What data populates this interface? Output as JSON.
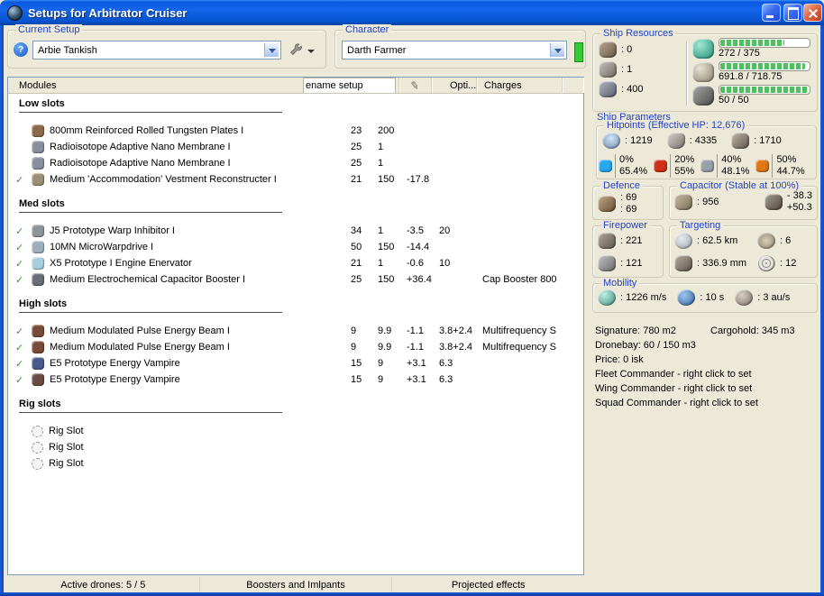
{
  "window": {
    "title": "Setups for Arbitrator Cruiser",
    "controls": [
      "minimize",
      "maximize",
      "close"
    ]
  },
  "icons": {
    "check": "✓",
    "help": "?",
    "pen": "✎"
  },
  "colors": {
    "indicator_green": "#33cc33",
    "bar_green": "#4fbf5f",
    "titlebar_blue": "#0a59e0"
  },
  "toolbar": {
    "current_setup": {
      "label": "Current Setup",
      "value": "Arbie Tankish"
    },
    "character": {
      "label": "Character",
      "value": "Darth Farmer"
    }
  },
  "tooltip": {
    "text": "ename setup"
  },
  "modules_panel": {
    "header": {
      "modules": "Modules",
      "opti": "Opti...",
      "charges": "Charges"
    },
    "sections": [
      {
        "title": "Low slots",
        "rows": [
          {
            "active": false,
            "icon": "armor-plate-icon",
            "icon_color": "#8a6a4a",
            "name": "800mm Reinforced Rolled Tungsten Plates I",
            "cpu": "23",
            "pg": "200",
            "cap": "",
            "opt": "",
            "charge": ""
          },
          {
            "active": false,
            "icon": "nano-membrane-icon",
            "icon_color": "#8a8fa0",
            "name": "Radioisotope Adaptive Nano Membrane I",
            "cpu": "25",
            "pg": "1",
            "cap": "",
            "opt": "",
            "charge": ""
          },
          {
            "active": false,
            "icon": "nano-membrane-icon",
            "icon_color": "#8a8fa0",
            "name": "Radioisotope Adaptive Nano Membrane I",
            "cpu": "25",
            "pg": "1",
            "cap": "",
            "opt": "",
            "charge": ""
          },
          {
            "active": true,
            "icon": "armor-repairer-icon",
            "icon_color": "#9a8f78",
            "name": "Medium 'Accommodation' Vestment Reconstructer I",
            "cpu": "21",
            "pg": "150",
            "cap": "-17.8",
            "opt": "",
            "charge": ""
          }
        ]
      },
      {
        "title": "Med slots",
        "rows": [
          {
            "active": true,
            "icon": "warp-scrambler-icon",
            "icon_color": "#8f9499",
            "name": "J5 Prototype Warp Inhibitor I",
            "cpu": "34",
            "pg": "1",
            "cap": "-3.5",
            "opt": "20",
            "charge": ""
          },
          {
            "active": true,
            "icon": "microwarpdrive-icon",
            "icon_color": "#9fb0bd",
            "name": "10MN MicroWarpdrive I",
            "cpu": "50",
            "pg": "150",
            "cap": "-14.4",
            "opt": "",
            "charge": ""
          },
          {
            "active": true,
            "icon": "stasis-web-icon",
            "icon_color": "#a8cede",
            "name": "X5 Prototype I Engine Enervator",
            "cpu": "21",
            "pg": "1",
            "cap": "-0.6",
            "opt": "10",
            "charge": ""
          },
          {
            "active": true,
            "icon": "cap-booster-icon",
            "icon_color": "#6a6f76",
            "name": "Medium Electrochemical Capacitor Booster I",
            "cpu": "25",
            "pg": "150",
            "cap": "+36.4",
            "opt": "",
            "charge": "Cap Booster 800"
          }
        ]
      },
      {
        "title": "High slots",
        "rows": [
          {
            "active": true,
            "icon": "energy-beam-icon",
            "icon_color": "#7a4a3a",
            "name": "Medium Modulated Pulse Energy Beam I",
            "cpu": "9",
            "pg": "9.9",
            "cap": "-1.1",
            "opt": "3.8+2.4",
            "charge": "Multifrequency S"
          },
          {
            "active": true,
            "icon": "energy-beam-icon",
            "icon_color": "#7a4a3a",
            "name": "Medium Modulated Pulse Energy Beam I",
            "cpu": "9",
            "pg": "9.9",
            "cap": "-1.1",
            "opt": "3.8+2.4",
            "charge": "Multifrequency S"
          },
          {
            "active": true,
            "icon": "energy-vampire-icon",
            "icon_color": "#4a5a8a",
            "name": "E5 Prototype Energy Vampire",
            "cpu": "15",
            "pg": "9",
            "cap": "+3.1",
            "opt": "6.3",
            "charge": ""
          },
          {
            "active": true,
            "icon": "energy-vampire-icon",
            "icon_color": "#6a4a42",
            "name": "E5 Prototype Energy Vampire",
            "cpu": "15",
            "pg": "9",
            "cap": "+3.1",
            "opt": "6.3",
            "charge": ""
          }
        ]
      },
      {
        "title": "Rig slots",
        "rows": [
          {
            "active": false,
            "icon": "rig-slot-icon",
            "icon_color": "",
            "name": "Rig Slot",
            "cpu": "",
            "pg": "",
            "cap": "",
            "opt": "",
            "charge": ""
          },
          {
            "active": false,
            "icon": "rig-slot-icon",
            "icon_color": "",
            "name": "Rig Slot",
            "cpu": "",
            "pg": "",
            "cap": "",
            "opt": "",
            "charge": ""
          },
          {
            "active": false,
            "icon": "rig-slot-icon",
            "icon_color": "",
            "name": "Rig Slot",
            "cpu": "",
            "pg": "",
            "cap": "",
            "opt": "",
            "charge": ""
          }
        ]
      }
    ]
  },
  "bottom_tabs": [
    {
      "label": "Active drones: 5 / 5"
    },
    {
      "label": "Boosters and Imlpants"
    },
    {
      "label": "Projected effects"
    }
  ],
  "ship_resources": {
    "label": "Ship Resources",
    "turrets": ": 0",
    "launchers": ": 1",
    "calibration": ": 400",
    "cpu": {
      "text": "272 / 375",
      "width": "72.5%"
    },
    "powergrid": {
      "text": "691.8 / 718.75",
      "width": "96.2%"
    },
    "drones": {
      "text": "50 / 50",
      "width": "100%"
    }
  },
  "ship_parameters": {
    "label": "Ship Parameters",
    "hitpoints": {
      "label": "Hitpoints (Effective HP: 12,676)",
      "shield": ": 1219",
      "armor": ": 4335",
      "structure": ": 1710",
      "resists": [
        {
          "name": "em",
          "color": "#28a8f0",
          "top": "0%",
          "bottom": "65.4%"
        },
        {
          "name": "explosive",
          "color": "#d03018",
          "top": "20%",
          "bottom": "55%"
        },
        {
          "name": "kinetic",
          "color": "#98a0a8",
          "top": "40%",
          "bottom": "48.1%"
        },
        {
          "name": "thermal",
          "color": "#e07818",
          "top": "50%",
          "bottom": "44.7%"
        }
      ]
    },
    "defence": {
      "label": "Defence",
      "value1": ": 69",
      "value2": ": 69"
    },
    "capacitor": {
      "label": "Capacitor (Stable at 100%)",
      "amount": ": 956",
      "delta_minus": "- 38.3",
      "delta_plus": "+50.3"
    },
    "firepower": {
      "label": "Firepower",
      "turret": ": 221",
      "missile": ": 121"
    },
    "targeting": {
      "label": "Targeting",
      "range": ": 62.5 km",
      "max_targets": ": 6",
      "scan_resolution": ": 336.9 mm",
      "sensor_strength": ": 12"
    },
    "mobility": {
      "label": "Mobility",
      "speed": ": 1226 m/s",
      "align_time": ": 10 s",
      "warp_speed": ": 3 au/s"
    }
  },
  "info": {
    "signature": "Signature: 780 m2",
    "cargohold": "Cargohold: 345 m3",
    "dronebay": "Dronebay: 60 / 150 m3",
    "price": "Price: 0 isk",
    "fleet": "Fleet Commander - right click to set",
    "wing": "Wing Commander - right click to set",
    "squad": "Squad Commander - right click to set"
  }
}
